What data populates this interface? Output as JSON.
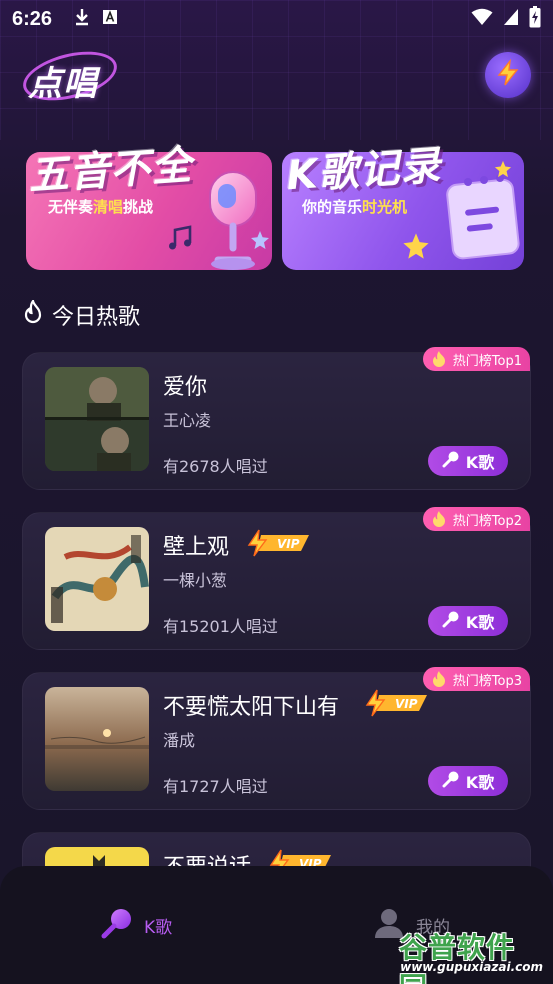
{
  "status_bar": {
    "time": "6:26"
  },
  "header": {
    "logo_text": "点唱"
  },
  "banners": [
    {
      "title": "五音不全",
      "subtitle_pre": "无伴奏",
      "subtitle_highlight": "清唱",
      "subtitle_post": "挑战"
    },
    {
      "title": "K歌记录",
      "subtitle_pre": "你的音乐",
      "subtitle_highlight": "时光机",
      "subtitle_post": ""
    }
  ],
  "section": {
    "title": "今日热歌"
  },
  "songs": [
    {
      "title": "爱你",
      "artist": "王心凌",
      "count": "有2678人唱过",
      "rank": "热门榜Top1",
      "vip": false,
      "button": "K歌"
    },
    {
      "title": "壁上观",
      "artist": "一棵小葱",
      "count": "有15201人唱过",
      "rank": "热门榜Top2",
      "vip": true,
      "vip_label": "VIP",
      "button": "K歌"
    },
    {
      "title": "不要慌太阳下山有",
      "artist": "潘成",
      "count": "有1727人唱过",
      "rank": "热门榜Top3",
      "vip": true,
      "vip_label": "VIP",
      "button": "K歌"
    },
    {
      "title": "不要说话",
      "vip": true,
      "vip_label": "VIP"
    }
  ],
  "bottom_nav": {
    "items": [
      {
        "label": "K歌",
        "active": true
      },
      {
        "label": "我的",
        "active": false
      }
    ]
  },
  "watermark": {
    "title": "谷普软件园",
    "url": "www.gupuxiazai.com"
  },
  "colors": {
    "accent_purple": "#b65cf0",
    "rank_pink": "#e843a3",
    "banner_pink": "#e34da6",
    "banner_purple": "#8f55ec"
  }
}
